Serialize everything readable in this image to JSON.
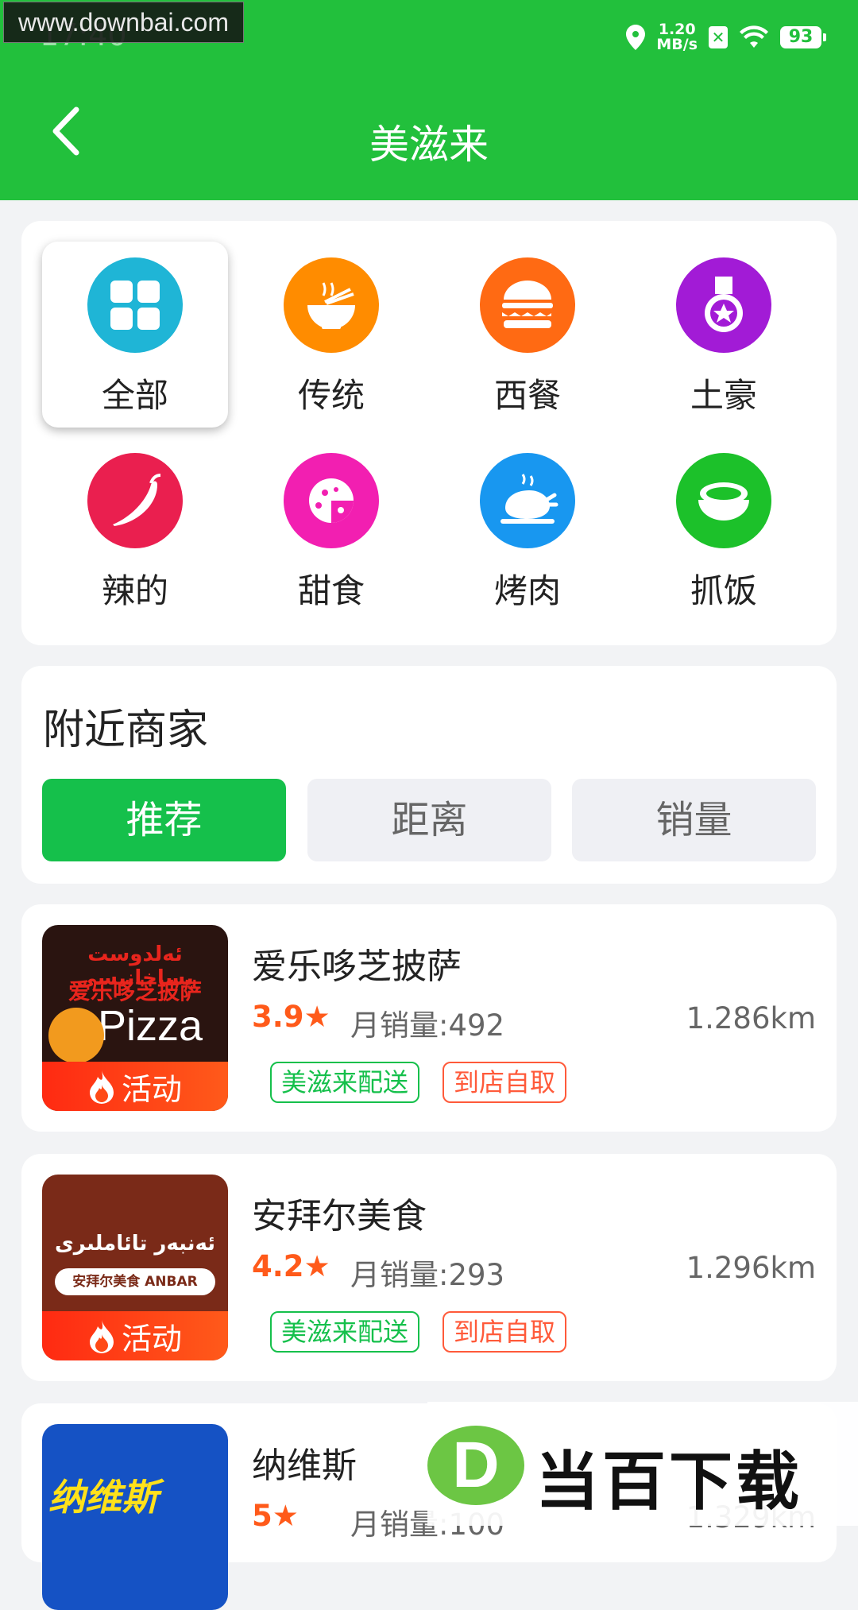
{
  "status_bar": {
    "time": "17:40",
    "watermark": "www.downbai.com",
    "net_speed_value": "1.20",
    "net_speed_unit": "MB/s",
    "battery": "93"
  },
  "header": {
    "title": "美滋来"
  },
  "categories": [
    {
      "label": "全部",
      "icon": "grid-icon",
      "color": "#1fb5d6"
    },
    {
      "label": "传统",
      "icon": "noodle-bowl-icon",
      "color": "#ff8c00"
    },
    {
      "label": "西餐",
      "icon": "burger-icon",
      "color": "#ff6a13"
    },
    {
      "label": "土豪",
      "icon": "medal-icon",
      "color": "#a21bd6"
    },
    {
      "label": "辣的",
      "icon": "chili-icon",
      "color": "#ea1f4f"
    },
    {
      "label": "甜食",
      "icon": "pizza-icon",
      "color": "#f21fb1"
    },
    {
      "label": "烤肉",
      "icon": "roast-chicken-icon",
      "color": "#1897f0"
    },
    {
      "label": "抓饭",
      "icon": "rice-bowl-icon",
      "color": "#1cc12a"
    }
  ],
  "nearby": {
    "title": "附近商家",
    "sort_options": [
      "推荐",
      "距离",
      "销量"
    ]
  },
  "stores": [
    {
      "name": "爱乐哆芝披萨",
      "rating": "3.9★",
      "sales": "月销量:492",
      "distance": "1.286km",
      "promo": "活动",
      "tags": [
        "美滋来配送",
        "到店自取"
      ],
      "thumb_text_top": "ئەلدوست پساخانىسى",
      "thumb_text_cn": "爱乐哆芝披萨",
      "thumb_text_logo": "Pizza"
    },
    {
      "name": "安拜尔美食",
      "rating": "4.2★",
      "sales": "月销量:293",
      "distance": "1.296km",
      "promo": "活动",
      "tags": [
        "美滋来配送",
        "到店自取"
      ],
      "thumb_text_top": "ئەنبەر تائاملىرى",
      "thumb_text_cn": "安拜尔美食 ANBAR"
    },
    {
      "name": "纳维斯",
      "rating": "5★",
      "sales": "月销量:100",
      "distance": "1.329km",
      "thumb_text_cn": "纳维斯"
    }
  ],
  "bottom_watermark": {
    "logo": "D",
    "text": "当百下载"
  }
}
